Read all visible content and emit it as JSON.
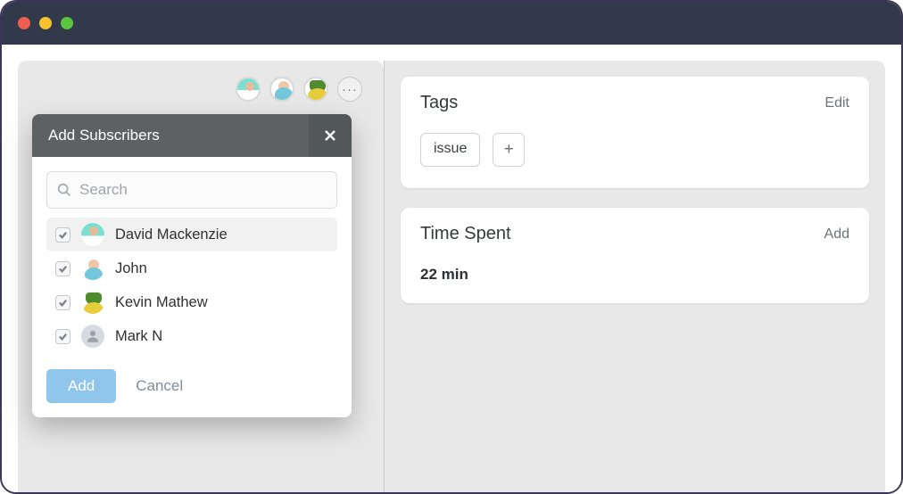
{
  "modal": {
    "title": "Add Subscribers",
    "search_placeholder": "Search",
    "add_label": "Add",
    "cancel_label": "Cancel",
    "users": [
      {
        "name": "David Mackenzie",
        "checked": true,
        "selected": true,
        "avatar": "david"
      },
      {
        "name": "John",
        "checked": true,
        "selected": false,
        "avatar": "john"
      },
      {
        "name": "Kevin Mathew",
        "checked": true,
        "selected": false,
        "avatar": "kevin"
      },
      {
        "name": "Mark N",
        "checked": true,
        "selected": false,
        "avatar": "generic"
      }
    ]
  },
  "header_avatars": [
    "david",
    "john",
    "kevin"
  ],
  "tags_card": {
    "title": "Tags",
    "action": "Edit",
    "tags": [
      "issue"
    ]
  },
  "time_card": {
    "title": "Time Spent",
    "action": "Add",
    "value": "22 min"
  }
}
